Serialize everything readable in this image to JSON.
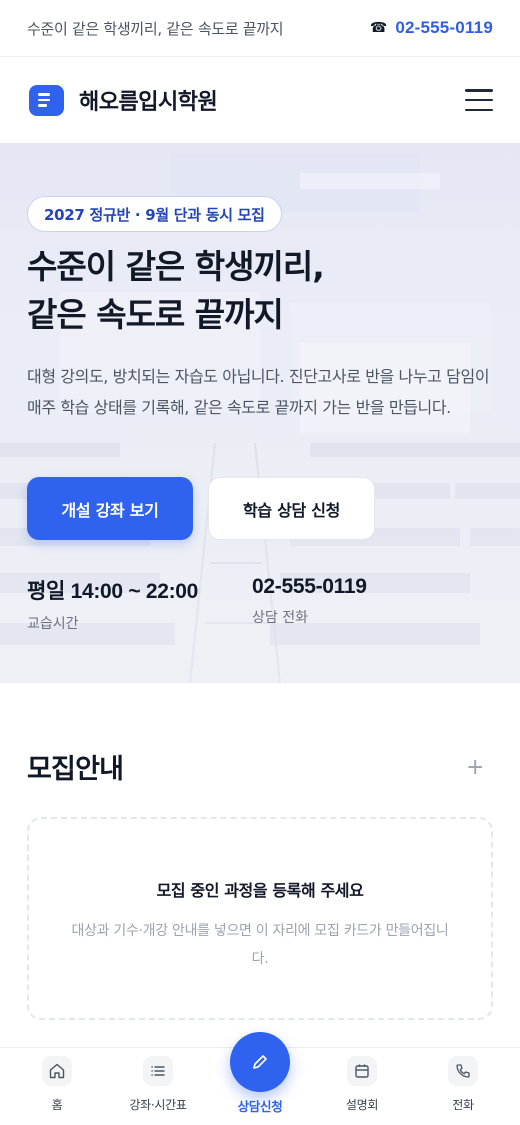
{
  "topbar": {
    "tagline": "수준이 같은 학생끼리, 같은 속도로 끝까지",
    "phone_icon": "phone-icon",
    "phone": "02-555-0119"
  },
  "header": {
    "brand": "해오름입시학원",
    "logo_icon": "document-lines-icon",
    "menu_icon": "hamburger-menu-icon"
  },
  "hero": {
    "badge": "2027 정규반 · 9월 단과 동시 모집",
    "headline_line1": "수준이 같은 학생끼리,",
    "headline_line2": "같은 속도로 끝까지",
    "description": "대형 강의도, 방치되는 자습도 아닙니다. 진단고사로 반을 나누고 담임이 매주 학습 상태를 기록해, 같은 속도로 끝까지 가는 반을 만듭니다.",
    "primary_button": "개설 강좌 보기",
    "secondary_button": "학습 상담 신청",
    "hours_value": "평일 14:00 ~ 22:00",
    "hours_label": "교습시간",
    "tel_value": "02-555-0119",
    "tel_label": "상담 전화"
  },
  "recruit": {
    "title": "모집안내",
    "plus": "+",
    "empty_title": "모집 중인 과정을 등록해 주세요",
    "empty_desc": "대상과 기수·개강 안내를 넣으면 이 자리에 모집 카드가 만들어집니다."
  },
  "bottom_nav": {
    "items": [
      {
        "label": "홈",
        "icon": "home-icon"
      },
      {
        "label": "강좌·시간표",
        "icon": "list-icon"
      },
      {
        "label": "상담신청",
        "icon": "pencil-icon"
      },
      {
        "label": "설명회",
        "icon": "calendar-icon"
      },
      {
        "label": "전화",
        "icon": "phone-icon"
      }
    ]
  },
  "colors": {
    "accent": "#2f62ee",
    "accent_text": "#2f5fe6",
    "badge_text": "#2445b5",
    "hero_bg": "#e8eaf5"
  }
}
